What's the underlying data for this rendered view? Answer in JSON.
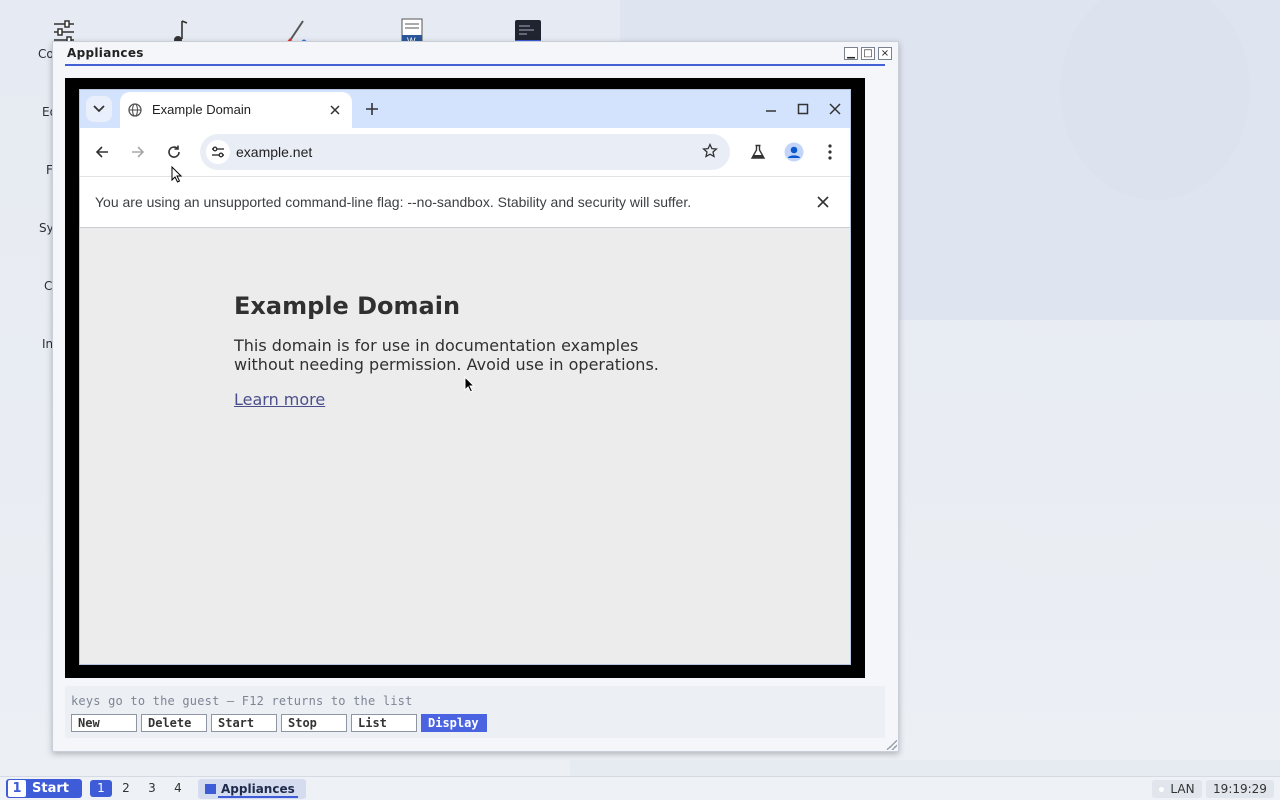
{
  "desktop": {
    "icons": [
      {
        "name": "settings-sliders-icon",
        "label": "Co"
      },
      {
        "name": "music-note-icon",
        "label": "Ed"
      },
      {
        "name": "paint-brush-icon",
        "label": "Fi"
      },
      {
        "name": "writer-document-icon",
        "label": "Sy"
      },
      {
        "name": "terminal-icon",
        "label": "Cl"
      },
      {
        "name": "unknown-icon",
        "label": "In"
      }
    ]
  },
  "window": {
    "title": "Appliances",
    "controls": {
      "minimize": "▁",
      "maximize": "□",
      "close": "×"
    }
  },
  "browser": {
    "tab_title": "Example Domain",
    "url": "example.net",
    "infobar_text": "You are using an unsupported command-line flag: --no-sandbox. Stability and security will suffer.",
    "page": {
      "heading": "Example Domain",
      "body": "This domain is for use in documentation examples without needing permission. Avoid use in operations.",
      "link": "Learn more"
    }
  },
  "panel": {
    "hint": "keys go to the guest – F12 returns to the list",
    "buttons": [
      "New",
      "Delete",
      "Start",
      "Stop",
      "List",
      "Display"
    ],
    "active_button": "Display"
  },
  "taskbar": {
    "start_label": "Start",
    "start_logo": "1",
    "workspaces": [
      "1",
      "2",
      "3",
      "4"
    ],
    "active_workspace": "1",
    "task_label": "Appliances",
    "network": "LAN",
    "clock": "19:19:29"
  },
  "colors": {
    "accent": "#3e5bd8",
    "chrome_tabstrip": "#d3e3fd",
    "page_bg": "#ececec"
  }
}
